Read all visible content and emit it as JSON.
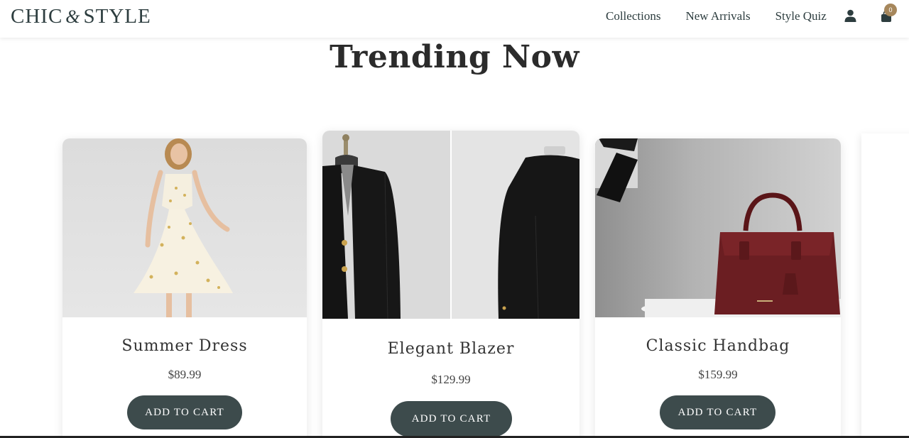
{
  "header": {
    "logo_left": "CHIC",
    "logo_amp": "&",
    "logo_right": "STYLE",
    "nav": [
      "Collections",
      "New Arrivals",
      "Style Quiz"
    ],
    "cart_count": "0",
    "icons": {
      "user": "user-icon",
      "cart": "shopping-bag-icon"
    }
  },
  "main": {
    "title": "Trending Now",
    "products": [
      {
        "name": "Summer Dress",
        "price": "$89.99",
        "button": "ADD TO CART"
      },
      {
        "name": "Elegant Blazer",
        "price": "$129.99",
        "button": "ADD TO CART"
      },
      {
        "name": "Classic Handbag",
        "price": "$159.99",
        "button": "ADD TO CART"
      }
    ]
  },
  "colors": {
    "brand_dark": "#2d3d3f",
    "button": "#3d4b4c",
    "badge": "#a6875c",
    "handbag": "#6b1e22"
  }
}
